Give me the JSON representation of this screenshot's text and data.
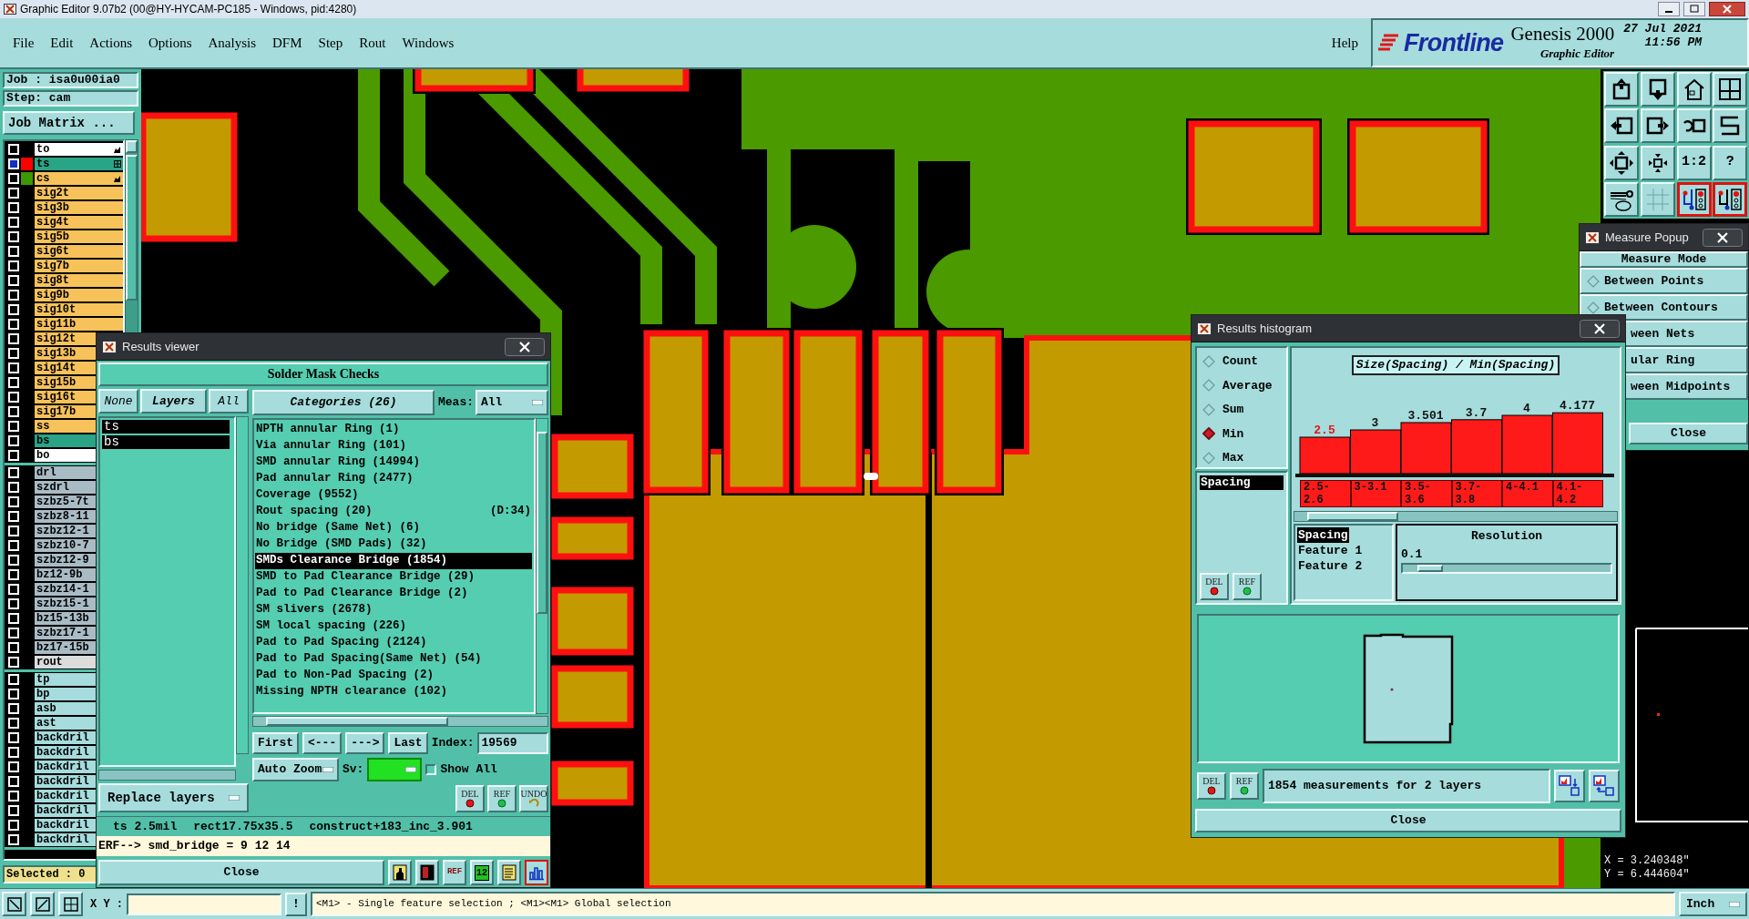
{
  "window": {
    "title": "Graphic Editor 9.07b2 (00@HY-HYCAM-PC185 - Windows, pid:4280)"
  },
  "menu": [
    "File",
    "Edit",
    "Actions",
    "Options",
    "Analysis",
    "DFM",
    "Step",
    "Rout",
    "Windows"
  ],
  "help": "Help",
  "brand": {
    "logo": "Frontline",
    "product": "Genesis 2000",
    "subtitle": "Graphic Editor",
    "date": "27 Jul 2021",
    "time": "11:56 PM"
  },
  "job": {
    "job": "Job : isa0u00ia0",
    "step": "Step: cam",
    "matrix_button": "Job Matrix ..."
  },
  "layer_groups": [
    {
      "layers": [
        {
          "name": "to",
          "kind": "outline",
          "checked": false,
          "pinned": true,
          "active": false
        },
        {
          "name": "ts",
          "kind": "mask",
          "color": "#ff0000",
          "checked": true,
          "pinned": false,
          "active": true
        },
        {
          "name": "cs",
          "kind": "signal",
          "color": "#3a9a00",
          "checked": false,
          "pinned": true,
          "active": false
        },
        {
          "name": "sig2t",
          "kind": "signal",
          "checked": false,
          "pinned": false,
          "active": false
        },
        {
          "name": "sig3b",
          "kind": "signal",
          "checked": false,
          "pinned": false,
          "active": false
        },
        {
          "name": "sig4t",
          "kind": "signal",
          "checked": false,
          "pinned": false,
          "active": false
        },
        {
          "name": "sig5b",
          "kind": "signal",
          "checked": false,
          "pinned": false,
          "active": false
        },
        {
          "name": "sig6t",
          "kind": "signal",
          "checked": false,
          "pinned": false,
          "active": false
        },
        {
          "name": "sig7b",
          "kind": "signal",
          "checked": false,
          "pinned": false,
          "active": false
        },
        {
          "name": "sig8t",
          "kind": "signal",
          "checked": false,
          "pinned": false,
          "active": false
        },
        {
          "name": "sig9b",
          "kind": "signal",
          "checked": false,
          "pinned": false,
          "active": false
        },
        {
          "name": "sig10t",
          "kind": "signal",
          "checked": false,
          "pinned": false,
          "active": false
        },
        {
          "name": "sig11b",
          "kind": "signal",
          "checked": false,
          "pinned": false,
          "active": false
        },
        {
          "name": "sig12t",
          "kind": "signal",
          "checked": false
        },
        {
          "name": "sig13b",
          "kind": "signal",
          "checked": false
        },
        {
          "name": "sig14t",
          "kind": "signal",
          "checked": false
        },
        {
          "name": "sig15b",
          "kind": "signal",
          "checked": false
        },
        {
          "name": "sig16t",
          "kind": "signal",
          "checked": false
        },
        {
          "name": "sig17b",
          "kind": "signal",
          "checked": false
        },
        {
          "name": "ss",
          "kind": "signal",
          "checked": false
        },
        {
          "name": "bs",
          "kind": "mask",
          "checked": false
        },
        {
          "name": "bo",
          "kind": "outline",
          "checked": false
        }
      ]
    },
    {
      "layers": [
        {
          "name": "drl",
          "kind": "drill",
          "checked": false
        },
        {
          "name": "szdrl",
          "kind": "drill",
          "checked": false
        },
        {
          "name": "szbz5-7t",
          "kind": "drill",
          "checked": false
        },
        {
          "name": "szbz8-11",
          "kind": "drill",
          "checked": false
        },
        {
          "name": "szbz12-1",
          "kind": "drill",
          "checked": false
        },
        {
          "name": "szbz10-7",
          "kind": "drill",
          "checked": false
        },
        {
          "name": "szbz12-9",
          "kind": "drill",
          "checked": false
        },
        {
          "name": "bz12-9b",
          "kind": "drill",
          "checked": false
        },
        {
          "name": "szbz14-1",
          "kind": "drill",
          "checked": false
        },
        {
          "name": "szbz15-1",
          "kind": "drill",
          "checked": false
        },
        {
          "name": "bz15-13b",
          "kind": "drill",
          "checked": false
        },
        {
          "name": "szbz17-1",
          "kind": "drill",
          "checked": false
        },
        {
          "name": "bz17-15b",
          "kind": "drill",
          "checked": false
        },
        {
          "name": "rout",
          "kind": "rout",
          "checked": false
        }
      ]
    },
    {
      "layers": [
        {
          "name": "tp",
          "kind": "doc",
          "checked": false
        },
        {
          "name": "bp",
          "kind": "doc",
          "checked": false
        },
        {
          "name": "asb",
          "kind": "doc",
          "checked": false
        },
        {
          "name": "ast",
          "kind": "doc",
          "checked": false
        },
        {
          "name": "backdril",
          "kind": "doc",
          "checked": false
        },
        {
          "name": "backdril",
          "kind": "doc",
          "checked": false
        },
        {
          "name": "backdril",
          "kind": "doc",
          "checked": false
        },
        {
          "name": "backdril",
          "kind": "doc",
          "checked": false
        },
        {
          "name": "backdril",
          "kind": "doc",
          "checked": false
        },
        {
          "name": "backdril",
          "kind": "doc",
          "checked": false
        },
        {
          "name": "backdril",
          "kind": "doc",
          "checked": false
        },
        {
          "name": "backdril",
          "kind": "doc",
          "checked": false
        }
      ]
    }
  ],
  "selected_count": "Selected : 0",
  "toolbar": [
    {
      "kind": "export",
      "on": false
    },
    {
      "kind": "import",
      "on": false
    },
    {
      "kind": "home",
      "on": false
    },
    {
      "kind": "quad",
      "on": false
    },
    {
      "kind": "left",
      "on": false
    },
    {
      "kind": "right",
      "on": false
    },
    {
      "kind": "undo",
      "on": false
    },
    {
      "kind": "zigzag",
      "on": false
    },
    {
      "kind": "expand",
      "on": false
    },
    {
      "kind": "shrink",
      "on": false
    },
    {
      "kind": "text",
      "label": "1:2",
      "on": false
    },
    {
      "kind": "text",
      "label": "?",
      "on": false
    },
    {
      "kind": "wrench",
      "on": false
    },
    {
      "kind": "grid",
      "on": false
    },
    {
      "kind": "net",
      "on": true
    },
    {
      "kind": "net",
      "on": true
    }
  ],
  "results_viewer": {
    "title": "Results viewer",
    "header": "Solder Mask Checks",
    "layer_buttons": [
      "None",
      "Layers",
      "All"
    ],
    "layers": [
      {
        "name": "ts",
        "selected": true
      },
      {
        "name": "bs",
        "selected": true
      }
    ],
    "replace": "Replace layers",
    "categories_button": "Categories (26)",
    "meas_label": "Meas:",
    "meas_value": "All",
    "categories": [
      {
        "label": "NPTH annular Ring (1)",
        "selected": false
      },
      {
        "label": "Via annular Ring (101)",
        "selected": false
      },
      {
        "label": "SMD annular Ring (14994)",
        "selected": false
      },
      {
        "label": "Pad annular Ring (2477)",
        "selected": false
      },
      {
        "label": "Coverage (9552)",
        "selected": false
      },
      {
        "label": "Rout spacing (20)",
        "note": "(D:34)",
        "selected": false
      },
      {
        "label": "No bridge (Same Net) (6)",
        "selected": false
      },
      {
        "label": "No Bridge (SMD Pads) (32)",
        "selected": false
      },
      {
        "label": "SMDs Clearance Bridge (1854)",
        "selected": true
      },
      {
        "label": "SMD to Pad Clearance Bridge (29)",
        "selected": false
      },
      {
        "label": "Pad to Pad Clearance Bridge (2)",
        "selected": false
      },
      {
        "label": "SM slivers (2678)",
        "selected": false
      },
      {
        "label": "SM local spacing (226)",
        "selected": false
      },
      {
        "label": "Pad to Pad Spacing (2124)",
        "selected": false
      },
      {
        "label": "Pad to Pad Spacing(Same Net) (54)",
        "selected": false
      },
      {
        "label": "Pad to Non-Pad Spacing (2)",
        "selected": false
      },
      {
        "label": "Missing NPTH clearance (102)",
        "selected": false
      }
    ],
    "nav": [
      "First",
      "<---",
      "--->",
      "Last"
    ],
    "index_label": "Index:",
    "index_value": "19569",
    "zoom": "Auto Zoom",
    "sv_label": "Sv:",
    "show_all": {
      "label": "Show All",
      "checked": false
    },
    "actions": [
      {
        "kind": "del",
        "label": "DEL"
      },
      {
        "kind": "ref",
        "label": "REF"
      },
      {
        "kind": "undo",
        "label": "UNDO"
      }
    ],
    "status": [
      "ts 2.5mil",
      "rect17.75x35.5",
      "construct+183_inc_3.901"
    ],
    "erf": "ERF--> smd_bridge = 9 12 14",
    "close": "Close",
    "tools": [
      {
        "kind": "person",
        "selected": false
      },
      {
        "kind": "panel",
        "selected": false
      },
      {
        "kind": "noref",
        "label": "REF",
        "selected": false
      },
      {
        "kind": "count",
        "label": "12",
        "selected": false
      },
      {
        "kind": "report",
        "selected": false
      },
      {
        "kind": "chart",
        "selected": true
      }
    ]
  },
  "histogram": {
    "title": "Results histogram",
    "modes": [
      {
        "label": "Count",
        "selected": false
      },
      {
        "label": "Average",
        "selected": false
      },
      {
        "label": "Sum",
        "selected": false
      },
      {
        "label": "Min",
        "selected": true
      },
      {
        "label": "Max",
        "selected": false
      }
    ],
    "attributes": [
      {
        "label": "Spacing",
        "selected": true
      }
    ],
    "chart_data": {
      "type": "bar",
      "title": "Size(Spacing) / Min(Spacing)",
      "categories": [
        "2.5-2.6",
        "3-3.1",
        "3.5-3.6",
        "3.7-3.8",
        "4-4.1",
        "4.1-4.2"
      ],
      "values": [
        2.5,
        3,
        3.501,
        3.7,
        4,
        4.177
      ],
      "data_labels": true
    },
    "fields": [
      {
        "label": "Spacing",
        "selected": true
      },
      {
        "label": "Feature 1",
        "selected": false
      },
      {
        "label": "Feature 2",
        "selected": false
      }
    ],
    "resolution": {
      "label": "Resolution",
      "value": "0.1",
      "level": 0.07
    },
    "list_actions": [
      {
        "kind": "del",
        "label": "DEL"
      },
      {
        "kind": "ref",
        "label": "REF"
      }
    ],
    "preview_actions": [
      {
        "kind": "del",
        "label": "DEL"
      },
      {
        "kind": "ref",
        "label": "REF"
      }
    ],
    "summary": "1854 measurements for 2 layers",
    "close": "Close"
  },
  "measure_popup": {
    "title": "Measure Popup",
    "header": "Measure Mode",
    "modes": [
      {
        "label": "Between Points",
        "partial": false,
        "selected": false
      },
      {
        "label": "Between Contours",
        "partial": false,
        "selected": false
      },
      {
        "label": "ween Nets",
        "partial": true
      },
      {
        "label": "ular Ring",
        "partial": true
      },
      {
        "label": "ween Midpoints",
        "partial": true
      }
    ],
    "close": "Close"
  },
  "coordinates": {
    "x": "X = 3.240348\"",
    "y": "Y = 6.444604\""
  },
  "status_bar": {
    "xy_label": "X Y :",
    "hint_button": "!",
    "message": "<M1> - Single feature selection ; <M1><M1> Global selection",
    "units": "Inch"
  }
}
